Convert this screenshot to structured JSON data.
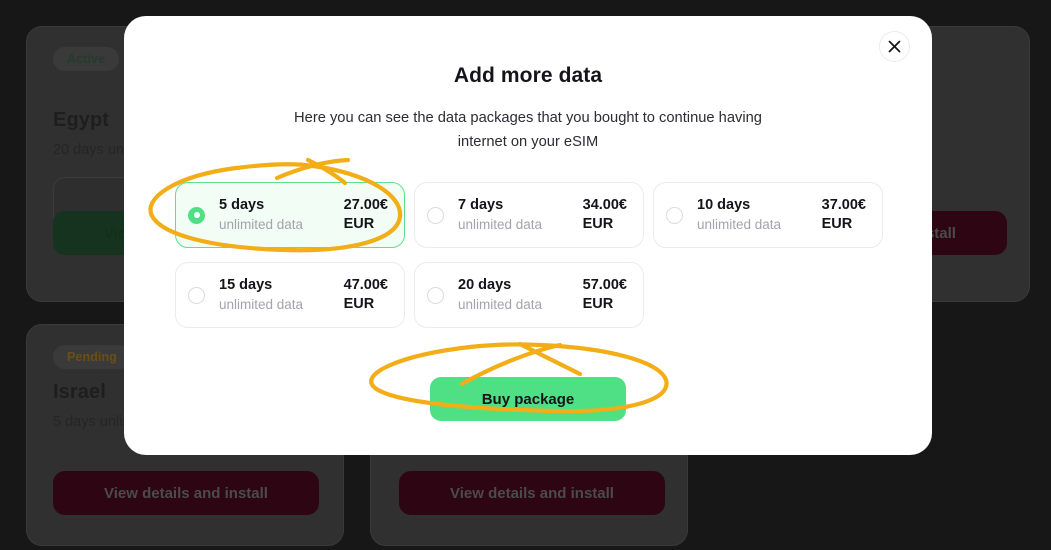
{
  "background": {
    "cards": [
      {
        "badge": "Active",
        "badge_type": "active",
        "title": "Egypt",
        "subtitle": "20 days unlimited data",
        "button_label": "View details and install"
      },
      {
        "badge": "Pending",
        "badge_type": "pending",
        "title": "Israel",
        "subtitle": "5 days unlimited data",
        "button_label": "View details and install"
      },
      {
        "button_label": "View details and install"
      },
      {
        "button_label": "View details and install"
      }
    ],
    "overlay_color": "#171717"
  },
  "modal": {
    "title": "Add more data",
    "subtitle": "Here you can see the data packages that you bought to continue having internet on your eSIM",
    "close_icon": "close-icon",
    "packages": [
      {
        "days": "5 days",
        "data": "unlimited data",
        "price": "27.00€",
        "currency": "EUR",
        "selected": true
      },
      {
        "days": "7 days",
        "data": "unlimited data",
        "price": "34.00€",
        "currency": "EUR",
        "selected": false
      },
      {
        "days": "10 days",
        "data": "unlimited data",
        "price": "37.00€",
        "currency": "EUR",
        "selected": false
      },
      {
        "days": "15 days",
        "data": "unlimited data",
        "price": "47.00€",
        "currency": "EUR",
        "selected": false
      },
      {
        "days": "20 days",
        "data": "unlimited data",
        "price": "57.00€",
        "currency": "EUR",
        "selected": false
      }
    ],
    "buy_button_label": "Buy package",
    "accent_green": "#4fe085",
    "selected_card_bg": "#f2fdf6",
    "selected_card_border": "#5fe08f"
  },
  "annotations": {
    "color": "#f2ad17",
    "shapes": [
      "ellipse-around-5-days-package",
      "ellipse-around-buy-package-button"
    ]
  }
}
